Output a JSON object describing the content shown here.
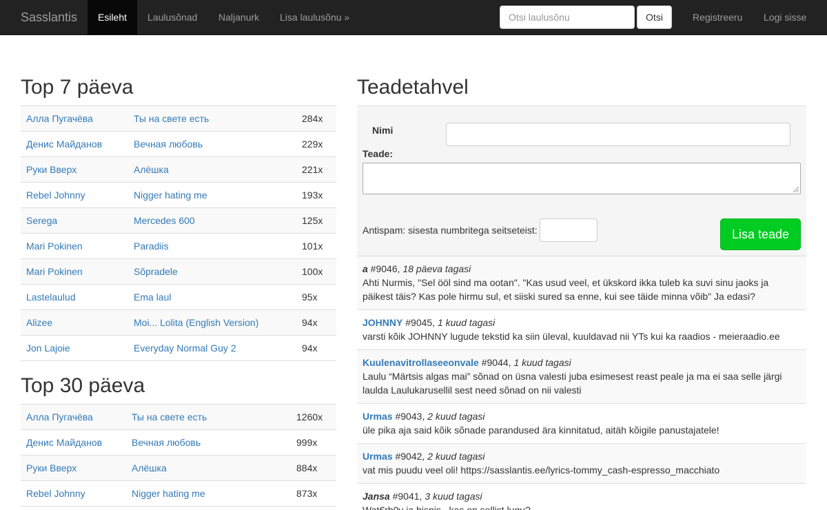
{
  "navbar": {
    "brand": "Sasslantis",
    "items": [
      {
        "label": "Esileht",
        "active": true
      },
      {
        "label": "Laulusõnad",
        "active": false
      },
      {
        "label": "Naljanurk",
        "active": false
      },
      {
        "label": "Lisa laulusõnu »",
        "active": false
      }
    ],
    "search_placeholder": "Otsi laulusõnu",
    "search_button": "Otsi",
    "register": "Registreeru",
    "login": "Logi sisse"
  },
  "top7": {
    "title": "Top 7 päeva",
    "rows": [
      {
        "artist": "Алла Пугачёва",
        "song": "Ты на свете есть",
        "count": "284x"
      },
      {
        "artist": "Денис Майданов",
        "song": "Вечная любовь",
        "count": "229x"
      },
      {
        "artist": "Руки Вверх",
        "song": "Алёшка",
        "count": "221x"
      },
      {
        "artist": "Rebel Johnny",
        "song": "Nigger hating me",
        "count": "193x"
      },
      {
        "artist": "Serega",
        "song": "Mercedes 600",
        "count": "125x"
      },
      {
        "artist": "Mari Pokinen",
        "song": "Paradiis",
        "count": "101x"
      },
      {
        "artist": "Mari Pokinen",
        "song": "Sõpradele",
        "count": "100x"
      },
      {
        "artist": "Lastelaulud",
        "song": "Ema laul",
        "count": "95x"
      },
      {
        "artist": "Alizee",
        "song": "Moi... Lolita (English Version)",
        "count": "94x"
      },
      {
        "artist": "Jon Lajoie",
        "song": "Everyday Normal Guy 2",
        "count": "94x"
      }
    ]
  },
  "top30": {
    "title": "Top 30 päeva",
    "rows": [
      {
        "artist": "Алла Пугачёва",
        "song": "Ты на свете есть",
        "count": "1260x"
      },
      {
        "artist": "Денис Майданов",
        "song": "Вечная любовь",
        "count": "999x"
      },
      {
        "artist": "Руки Вверх",
        "song": "Алёшка",
        "count": "884x"
      },
      {
        "artist": "Rebel Johnny",
        "song": "Nigger hating me",
        "count": "873x"
      }
    ]
  },
  "board": {
    "title": "Teadetahvel",
    "name_label": "Nimi",
    "message_label": "Teade:",
    "antispam_label": "Antispam: sisesta numbritega seitseteist:",
    "submit": "Lisa teade",
    "messages": [
      {
        "author": "a",
        "author_link": false,
        "meta": " #9046, ",
        "time": "18 päeva tagasi",
        "text": "Ahti Nurmis, \"Sel ööl sind ma ootan\". \"Kas usud veel, et ükskord ikka tuleb ka suvi sinu jaoks ja päikest täis? Kas pole hirmu sul, et siiski sured sa enne, kui see täide minna võib\" Ja edasi?"
      },
      {
        "author": "JOHNNY",
        "author_link": true,
        "meta": " #9045, ",
        "time": "1 kuud tagasi",
        "text": "varsti kõik JOHNNY lugude tekstid ka siin üleval, kuuldavad nii YTs kui ka raadios - meieraadio.ee"
      },
      {
        "author": "Kuulenavitrollaseeonvale",
        "author_link": true,
        "meta": " #9044, ",
        "time": "1 kuud tagasi",
        "text": "Laulu “Märtsis algas mai” sõnad on üsna valesti juba esimesest reast peale ja ma ei saa selle järgi laulda Laulukarusellil sest need sõnad on nii valesti"
      },
      {
        "author": "Urmas",
        "author_link": true,
        "meta": " #9043, ",
        "time": "2 kuud tagasi",
        "text": "üle pika aja said kõik sõnade parandused ära kinnitatud, aitäh kõigile panustajatele!"
      },
      {
        "author": "Urmas",
        "author_link": true,
        "meta": " #9042, ",
        "time": "2 kuud tagasi",
        "text": "vat mis puudu veel oli! https://sasslantis.ee/lyrics-tommy_cash-espresso_macchiato"
      },
      {
        "author": "Jansa",
        "author_link": false,
        "meta": " #9041, ",
        "time": "3 kuud tagasi",
        "text": "Wat€rb0y ja bisnis , kas on sellist lugu?"
      }
    ]
  }
}
